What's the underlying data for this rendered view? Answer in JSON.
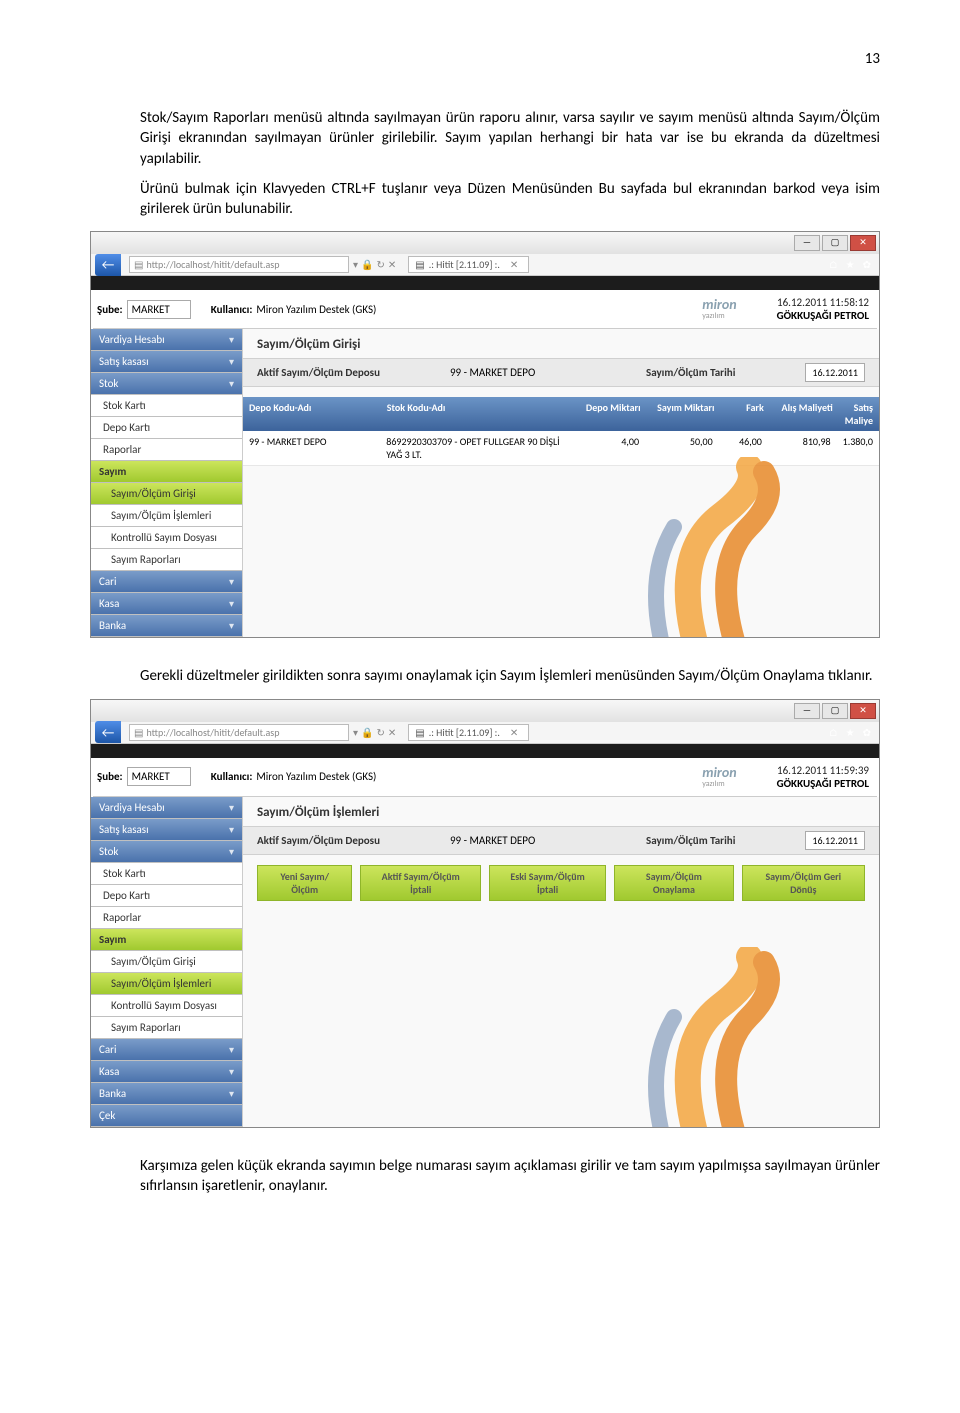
{
  "page_number": "13",
  "body_text": {
    "p1": "Stok/Sayım Raporları menüsü altında sayılmayan ürün raporu alınır, varsa sayılır ve sayım menüsü altında Sayım/Ölçüm Girişi ekranından sayılmayan ürünler girilebilir. Sayım yapılan herhangi bir hata var ise bu ekranda da düzeltmesi yapılabilir.",
    "p2": "Ürünü bulmak için Klavyeden CTRL+F tuşlanır veya Düzen Menüsünden Bu sayfada bul ekranından barkod veya isim girilerek ürün bulunabilir.",
    "p3": "Gerekli düzeltmeler girildikten sonra sayımı onaylamak için Sayım İşlemleri menüsünden Sayım/Ölçüm Onaylama tıklanır.",
    "p4": "Karşımıza gelen küçük ekranda sayımın belge numarası sayım açıklaması girilir ve tam sayım yapılmışsa sayılmayan ürünler sıfırlansın işaretlenir, onaylanır."
  },
  "common": {
    "url": "http://localhost/hitit/default.asp",
    "tab_title": ".: Hitit [2.11.09] :.",
    "sube_label": "Şube:",
    "sube_value": "MARKET",
    "user_label": "Kullanıcı:",
    "user_value": "Miron Yazılım Destek (GKS)",
    "logo_text": "miron",
    "logo_sub": "yazılım",
    "company": "GÖKKUŞAĞI PETROL",
    "active_depo_label": "Aktif Sayım/Ölçüm Deposu",
    "active_depo_value": "99 - MARKET DEPO",
    "date_label": "Sayım/Ölçüm Tarihi",
    "date_value": "16.12.2011"
  },
  "sidebar": {
    "items": [
      {
        "label": "Vardiya Hesabı",
        "style": "grad"
      },
      {
        "label": "Satış kasası",
        "style": "grad"
      },
      {
        "label": "Stok",
        "style": "grad"
      },
      {
        "label": "Stok Kartı",
        "style": "white"
      },
      {
        "label": "Depo Kartı",
        "style": "white"
      },
      {
        "label": "Raporlar",
        "style": "white"
      },
      {
        "label": "Sayım",
        "style": "lime"
      },
      {
        "label": "Sayım/Ölçüm Girişi",
        "style": "white-sub"
      },
      {
        "label": "Sayım/Ölçüm İşlemleri",
        "style": "white-sub"
      },
      {
        "label": "Kontrollü Sayım Dosyası",
        "style": "white-sub"
      },
      {
        "label": "Sayım Raporları",
        "style": "white-sub"
      },
      {
        "label": "Cari",
        "style": "grad"
      },
      {
        "label": "Kasa",
        "style": "grad"
      },
      {
        "label": "Banka",
        "style": "grad"
      }
    ],
    "items2_extra": {
      "label": "Çek",
      "style": "grad"
    }
  },
  "screenshot1": {
    "timestamp": "16.12.2011 11:58:12",
    "screen_title": "Sayım/Ölçüm Girişi",
    "highlight_sub_index": 7,
    "table": {
      "headers": [
        "Depo Kodu-Adı",
        "Stok Kodu-Adı",
        "Depo Miktarı",
        "Sayım Miktarı",
        "Fark",
        "Alış Maliyeti",
        "Satış Maliye"
      ],
      "row": [
        "99 - MARKET DEPO",
        "8692920303709 - OPET FULLGEAR 90 DİŞLİ YAĞ 3 LT.",
        "4,00",
        "50,00",
        "46,00",
        "810,98",
        "1.380,0"
      ]
    }
  },
  "screenshot2": {
    "timestamp": "16.12.2011 11:59:39",
    "screen_title": "Sayım/Ölçüm İşlemleri",
    "highlight_sub_index": 8,
    "buttons": [
      "Yeni Sayım/Ölçüm",
      "Aktif Sayım/Ölçüm İptali",
      "Eski Sayım/Ölçüm İptali",
      "Sayım/Ölçüm Onaylama",
      "Sayım/Ölçüm Geri Dönüş"
    ]
  }
}
